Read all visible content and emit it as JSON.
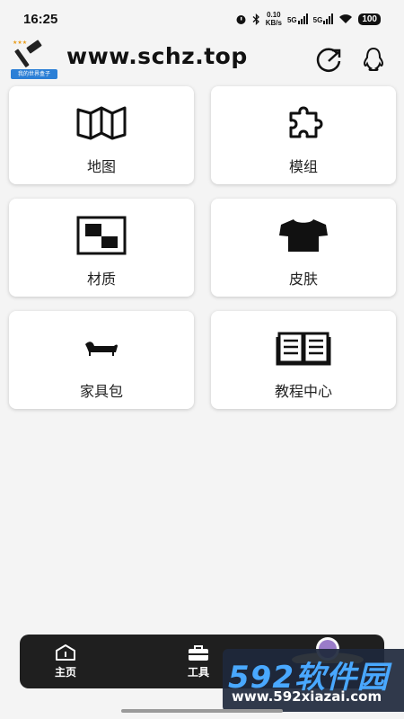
{
  "status": {
    "time": "16:25",
    "net_speed": "0.10",
    "net_unit": "KB/s",
    "sim1": "5G",
    "sim2": "5G",
    "battery": "100"
  },
  "header": {
    "logo_caption": "我的世界盒子",
    "site": "www.schz.top",
    "share_icon": "share-icon",
    "qq_icon": "qq-penguin-icon"
  },
  "cards": [
    {
      "label": "地图",
      "icon": "map-icon"
    },
    {
      "label": "模组",
      "icon": "puzzle-icon"
    },
    {
      "label": "材质",
      "icon": "texture-icon"
    },
    {
      "label": "皮肤",
      "icon": "tshirt-icon"
    },
    {
      "label": "家具包",
      "icon": "sofa-icon"
    },
    {
      "label": "教程中心",
      "icon": "book-icon"
    }
  ],
  "tabs": [
    {
      "label": "主页",
      "icon": "home-icon"
    },
    {
      "label": "工具",
      "icon": "toolbox-icon"
    }
  ],
  "watermark": {
    "brand": "592软件园",
    "url": "www.592xiazai.com"
  },
  "colors": {
    "card_bg": "#ffffff",
    "page_bg": "#f4f4f4",
    "tabbar_bg": "#1f1f1f",
    "watermark_accent": "#49a8ff"
  }
}
